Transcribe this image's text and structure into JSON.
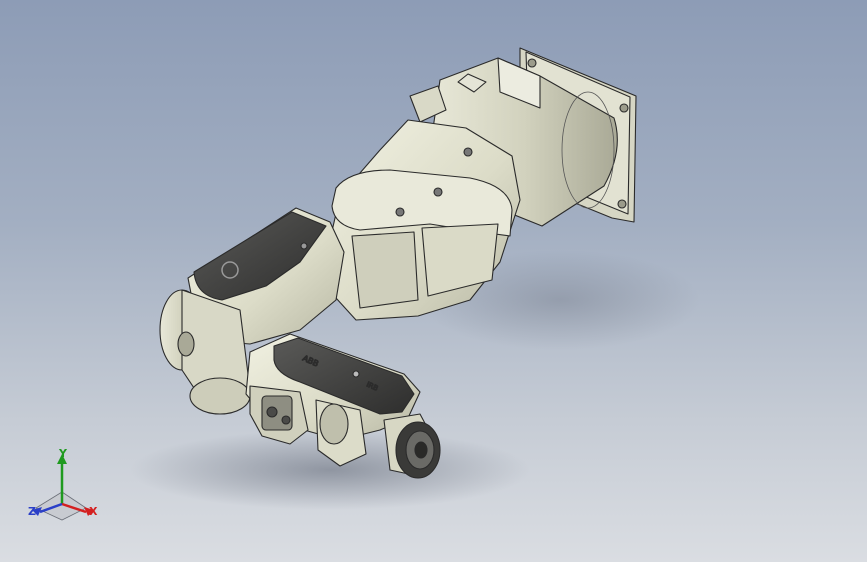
{
  "viewport": {
    "background_top": "#8d9cb6",
    "background_bottom": "#dadde2",
    "model_name": "",
    "model_icon": "six-axis-robot-arm-icon"
  },
  "triad": {
    "icon": "view-orientation-triad-icon",
    "axis_x": "X",
    "axis_y": "Y",
    "axis_z": "Z",
    "color_x": "#d42020",
    "color_y": "#1f9a1f",
    "color_z": "#2a3fc8"
  }
}
